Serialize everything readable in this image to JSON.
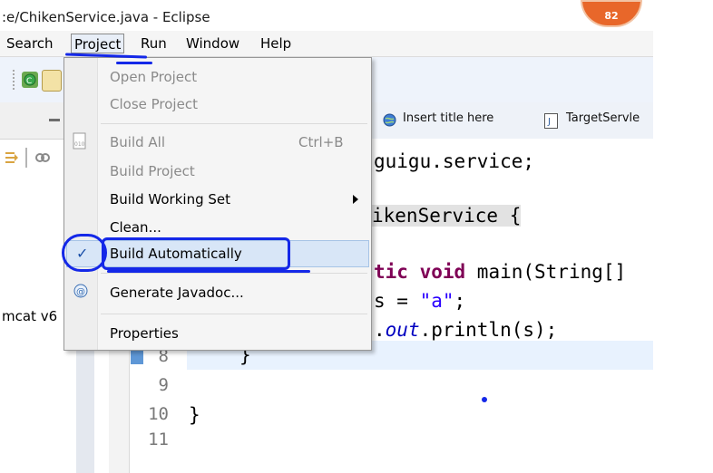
{
  "window": {
    "title": ":e/ChikenService.java - Eclipse",
    "badge_count": "82"
  },
  "menubar": {
    "items": [
      "Search",
      "Project",
      "Run",
      "Window",
      "Help"
    ]
  },
  "editor_tabs": [
    {
      "icon": "globe-icon",
      "label": "Insert title here"
    },
    {
      "icon": "java-file-icon",
      "label": "TargetServle"
    }
  ],
  "left_pane": {
    "label": "mcat v6"
  },
  "project_menu": {
    "items": [
      {
        "label": "Open Project",
        "enabled": false
      },
      {
        "label": "Close Project",
        "enabled": false
      },
      {
        "label": "Build All",
        "shortcut": "Ctrl+B",
        "enabled": false,
        "icon": "build-all-icon"
      },
      {
        "label": "Build Project",
        "enabled": false
      },
      {
        "label": "Build Working Set",
        "enabled": true,
        "submenu": true
      },
      {
        "label": "Clean...",
        "enabled": true
      },
      {
        "label": "Build Automatically",
        "enabled": true,
        "checked": true
      },
      {
        "label": "Generate Javadoc...",
        "enabled": true,
        "icon": "javadoc-icon"
      },
      {
        "label": "Properties",
        "enabled": true
      }
    ]
  },
  "code": {
    "line_numbers": [
      "8",
      "9",
      "10",
      "11"
    ],
    "lines": {
      "package_tail": "guigu.service;",
      "class_tail": "ikenService {",
      "main_kw1": "tic ",
      "main_kw2": "void",
      "main_rest": " main(String[]",
      "assign_lhs": "s = ",
      "assign_str": "\"a\"",
      "assign_end": ";",
      "println_dot": ".",
      "println_out": "out",
      "println_rest": ".println(s);",
      "closing_brace_1": "}",
      "closing_brace_2": "}"
    }
  }
}
